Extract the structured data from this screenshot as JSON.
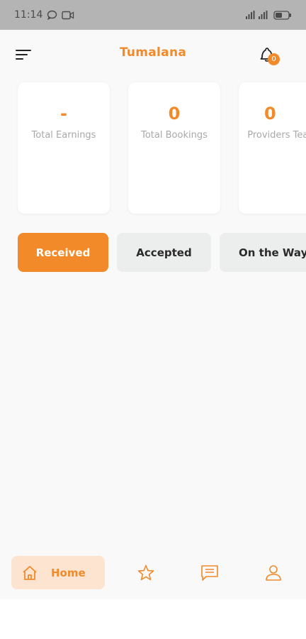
{
  "status_bar": {
    "time": "11:14",
    "icons": [
      "chat-bubble-icon",
      "video-icon",
      "signal-icon",
      "battery-icon"
    ]
  },
  "app_bar": {
    "title": "Tumalana",
    "menu_icon": "sort-menu-icon",
    "notification_icon": "bell-icon",
    "notification_count": "0"
  },
  "stats": [
    {
      "value": "-",
      "label": "Total Earnings"
    },
    {
      "value": "0",
      "label": "Total Bookings"
    },
    {
      "value": "0",
      "label": "Providers Teams"
    }
  ],
  "tabs": [
    {
      "label": "Received",
      "active": true
    },
    {
      "label": "Accepted",
      "active": false
    },
    {
      "label": "On the Way",
      "active": false
    }
  ],
  "bottom_nav": {
    "home_label": "Home",
    "items": [
      "home-icon",
      "star-icon",
      "message-icon",
      "profile-icon"
    ]
  },
  "colors": {
    "accent": "#f28a2a",
    "accent_light": "#fde4d0",
    "background": "#f9f9f9",
    "card": "#ffffff",
    "status_bar": "#b4b4b4",
    "inactive_tab": "#eceded"
  }
}
